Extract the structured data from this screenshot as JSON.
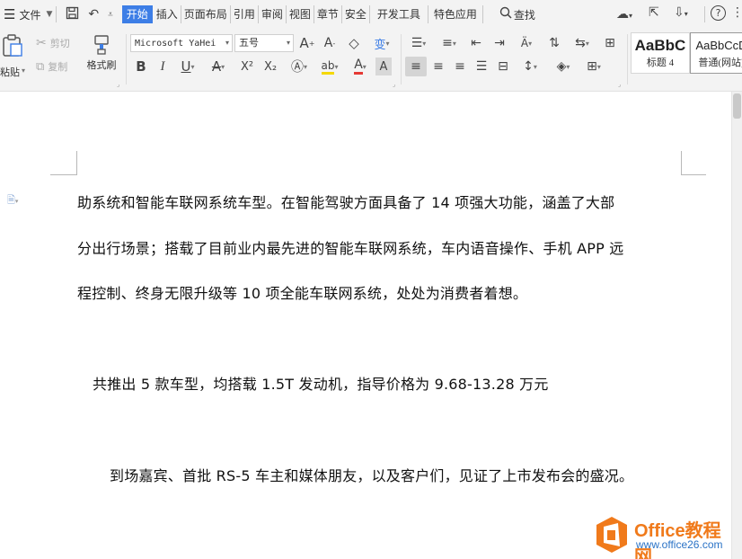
{
  "tabbar": {
    "file_label": "文件",
    "tabs": [
      "开始",
      "插入",
      "页面布局",
      "引用",
      "审阅",
      "视图",
      "章节",
      "安全",
      "开发工具",
      "特色应用"
    ],
    "active_tab": "开始",
    "search_label": "查找"
  },
  "ribbon": {
    "paste_label": "粘贴",
    "cut_label": "剪切",
    "copy_label": "复制",
    "format_painter_label": "格式刷",
    "font_name": "Microsoft YaHei",
    "font_size": "五号",
    "style_heading4_sample": "AaBbC",
    "style_heading4_label": "标题 4",
    "style_normal_sample": "AaBbCcD",
    "style_normal_label": "普通(网站)",
    "bold": "B",
    "italic": "I",
    "underline": "U",
    "strike": "A",
    "superscript": "X²",
    "subscript": "X₂",
    "font_color": "A"
  },
  "document": {
    "paragraphs": [
      "助系统和智能车联网系统车型。在智能驾驶方面具备了 14 项强大功能，涵盖了大部",
      "分出行场景；搭载了目前业内最先进的智能车联网系统，车内语音操作、手机 APP 远",
      "程控制、终身无限升级等 10 项全能车联网系统，处处为消费者着想。",
      "共推出 5 款车型，均搭载 1.5T 发动机，指导价格为 9.68-13.28 万元",
      "到场嘉宾、首批 RS-5 车主和媒体朋友，以及客户们，见证了上市发布会的盛况。"
    ]
  },
  "watermark": {
    "title": "Office教程网",
    "url": "www.office26.com"
  },
  "colors": {
    "accent": "#3d7ee6",
    "logo_orange": "#f07a1b",
    "logo_blue": "#2b73c6",
    "font_color_red": "#e53935",
    "highlight_yellow": "#f5d800"
  }
}
